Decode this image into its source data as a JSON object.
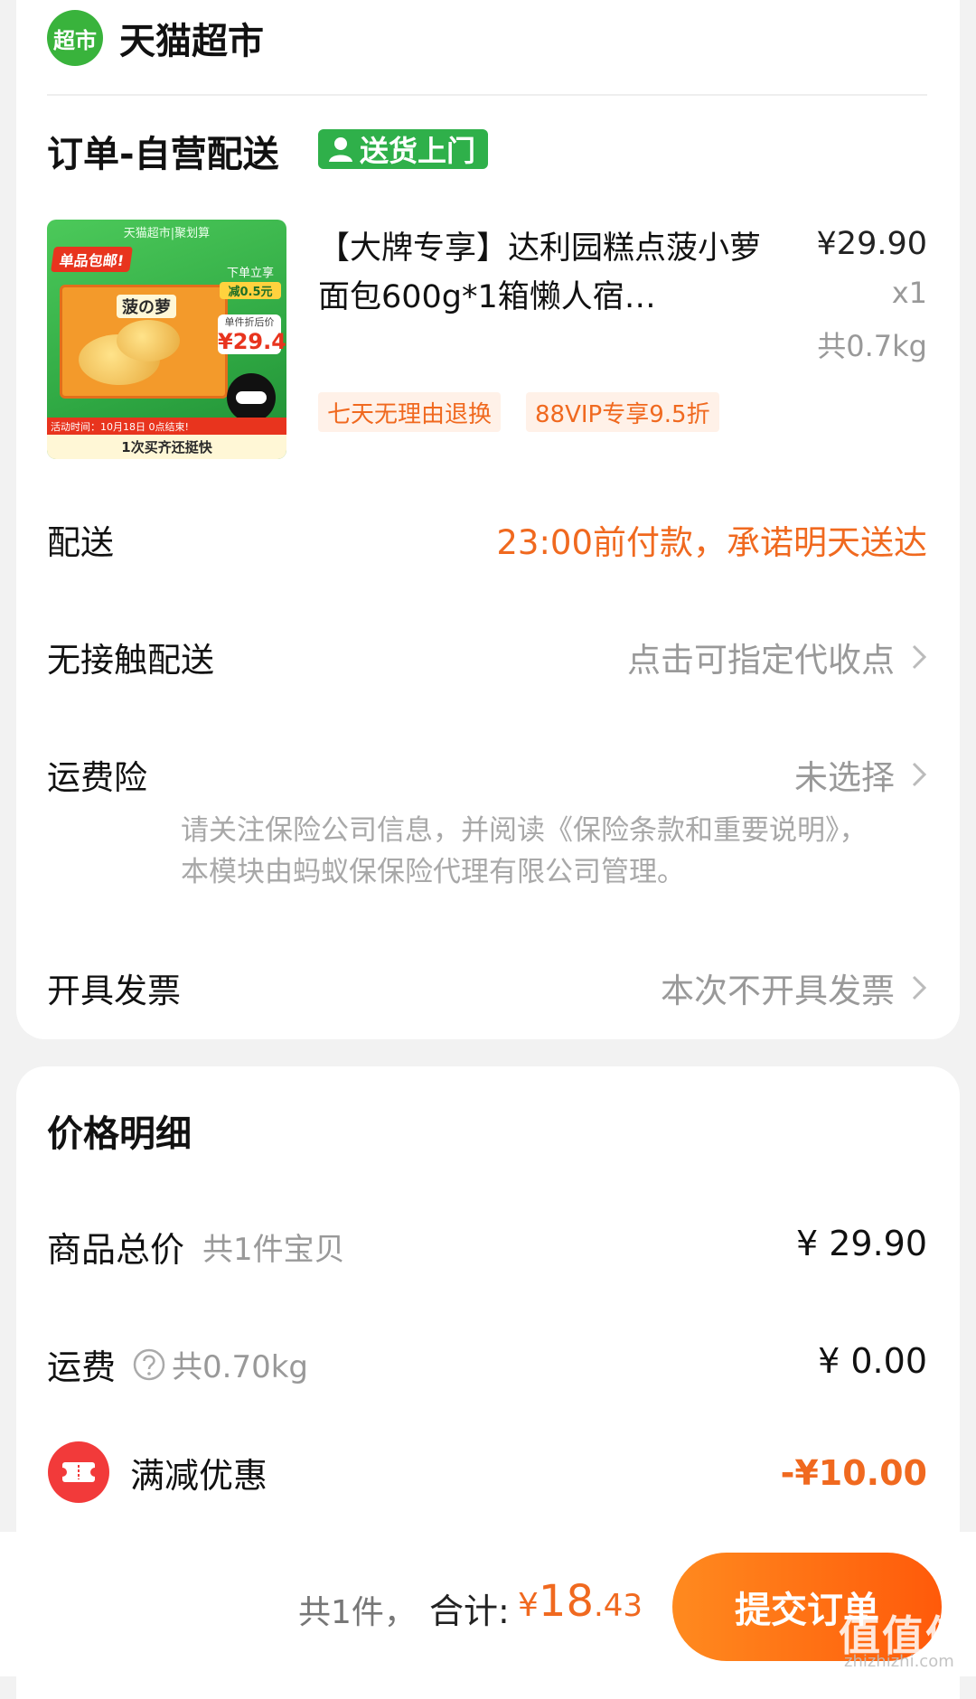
{
  "store": {
    "logo_text": "超市",
    "name": "天猫超市"
  },
  "order": {
    "title": "订单-自营配送",
    "delivery_tag": "送货上门"
  },
  "product": {
    "title": "【大牌专享】达利园糕点菠小萝面包600g*1箱懒人宿…",
    "price": "¥29.90",
    "qty": "x1",
    "weight": "共0.7kg",
    "tags": [
      "七天无理由退换",
      "88VIP专享9.5折"
    ],
    "image": {
      "top_text": "天猫超市|聚划算",
      "ribbon": "单品包邮!",
      "side_line1": "下单立享",
      "side_cut": "减0.5元",
      "price_label": "单件折后价",
      "price_value": "¥29.4",
      "box_label": "菠の萝",
      "time_text": "活动时间：10月18日 0点结束!",
      "bottom_text": "1次买齐还挺快"
    }
  },
  "rows": {
    "delivery": {
      "label": "配送",
      "value": "23:00前付款，承诺明天送达"
    },
    "contactless": {
      "label": "无接触配送",
      "value": "点击可指定代收点"
    },
    "insurance": {
      "label": "运费险",
      "value": "未选择",
      "note": "请关注保险公司信息，并阅读《保险条款和重要说明》，本模块由蚂蚁保保险代理有限公司管理。"
    },
    "invoice": {
      "label": "开具发票",
      "value": "本次不开具发票"
    }
  },
  "price_detail": {
    "title": "价格明细",
    "goods_total": {
      "label": "商品总价",
      "sub": "共1件宝贝",
      "value": "¥ 29.90"
    },
    "shipping": {
      "label": "运费",
      "sub": "共0.70kg",
      "value": "¥ 0.00"
    },
    "discount": {
      "label": "满减优惠",
      "value": "-¥10.00"
    }
  },
  "bottom": {
    "count": "共1件，",
    "total_label": "合计:",
    "total_currency": "¥",
    "total_int": "18",
    "total_dec": ".43",
    "submit": "提交订单"
  },
  "watermark": {
    "text": "值值值",
    "sub": "zhizhizhi.com"
  },
  "colors": {
    "accent": "#f0691f",
    "store_green": "#39b33c",
    "tag_green": "#2fb04a"
  },
  "icons": [
    "chevron-right-icon",
    "question-circle-icon",
    "coupon-icon",
    "person-icon"
  ]
}
